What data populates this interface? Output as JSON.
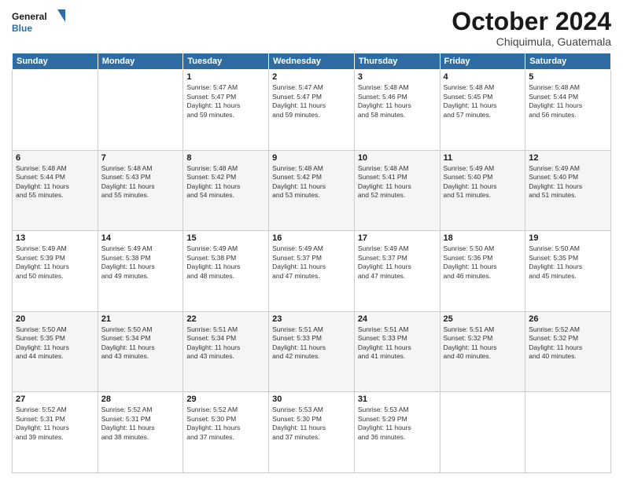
{
  "logo": {
    "line1": "General",
    "line2": "Blue"
  },
  "title": "October 2024",
  "subtitle": "Chiquimula, Guatemala",
  "days_header": [
    "Sunday",
    "Monday",
    "Tuesday",
    "Wednesday",
    "Thursday",
    "Friday",
    "Saturday"
  ],
  "weeks": [
    [
      {
        "day": "",
        "info": ""
      },
      {
        "day": "",
        "info": ""
      },
      {
        "day": "1",
        "info": "Sunrise: 5:47 AM\nSunset: 5:47 PM\nDaylight: 11 hours\nand 59 minutes."
      },
      {
        "day": "2",
        "info": "Sunrise: 5:47 AM\nSunset: 5:47 PM\nDaylight: 11 hours\nand 59 minutes."
      },
      {
        "day": "3",
        "info": "Sunrise: 5:48 AM\nSunset: 5:46 PM\nDaylight: 11 hours\nand 58 minutes."
      },
      {
        "day": "4",
        "info": "Sunrise: 5:48 AM\nSunset: 5:45 PM\nDaylight: 11 hours\nand 57 minutes."
      },
      {
        "day": "5",
        "info": "Sunrise: 5:48 AM\nSunset: 5:44 PM\nDaylight: 11 hours\nand 56 minutes."
      }
    ],
    [
      {
        "day": "6",
        "info": "Sunrise: 5:48 AM\nSunset: 5:44 PM\nDaylight: 11 hours\nand 55 minutes."
      },
      {
        "day": "7",
        "info": "Sunrise: 5:48 AM\nSunset: 5:43 PM\nDaylight: 11 hours\nand 55 minutes."
      },
      {
        "day": "8",
        "info": "Sunrise: 5:48 AM\nSunset: 5:42 PM\nDaylight: 11 hours\nand 54 minutes."
      },
      {
        "day": "9",
        "info": "Sunrise: 5:48 AM\nSunset: 5:42 PM\nDaylight: 11 hours\nand 53 minutes."
      },
      {
        "day": "10",
        "info": "Sunrise: 5:48 AM\nSunset: 5:41 PM\nDaylight: 11 hours\nand 52 minutes."
      },
      {
        "day": "11",
        "info": "Sunrise: 5:49 AM\nSunset: 5:40 PM\nDaylight: 11 hours\nand 51 minutes."
      },
      {
        "day": "12",
        "info": "Sunrise: 5:49 AM\nSunset: 5:40 PM\nDaylight: 11 hours\nand 51 minutes."
      }
    ],
    [
      {
        "day": "13",
        "info": "Sunrise: 5:49 AM\nSunset: 5:39 PM\nDaylight: 11 hours\nand 50 minutes."
      },
      {
        "day": "14",
        "info": "Sunrise: 5:49 AM\nSunset: 5:38 PM\nDaylight: 11 hours\nand 49 minutes."
      },
      {
        "day": "15",
        "info": "Sunrise: 5:49 AM\nSunset: 5:38 PM\nDaylight: 11 hours\nand 48 minutes."
      },
      {
        "day": "16",
        "info": "Sunrise: 5:49 AM\nSunset: 5:37 PM\nDaylight: 11 hours\nand 47 minutes."
      },
      {
        "day": "17",
        "info": "Sunrise: 5:49 AM\nSunset: 5:37 PM\nDaylight: 11 hours\nand 47 minutes."
      },
      {
        "day": "18",
        "info": "Sunrise: 5:50 AM\nSunset: 5:36 PM\nDaylight: 11 hours\nand 46 minutes."
      },
      {
        "day": "19",
        "info": "Sunrise: 5:50 AM\nSunset: 5:35 PM\nDaylight: 11 hours\nand 45 minutes."
      }
    ],
    [
      {
        "day": "20",
        "info": "Sunrise: 5:50 AM\nSunset: 5:35 PM\nDaylight: 11 hours\nand 44 minutes."
      },
      {
        "day": "21",
        "info": "Sunrise: 5:50 AM\nSunset: 5:34 PM\nDaylight: 11 hours\nand 43 minutes."
      },
      {
        "day": "22",
        "info": "Sunrise: 5:51 AM\nSunset: 5:34 PM\nDaylight: 11 hours\nand 43 minutes."
      },
      {
        "day": "23",
        "info": "Sunrise: 5:51 AM\nSunset: 5:33 PM\nDaylight: 11 hours\nand 42 minutes."
      },
      {
        "day": "24",
        "info": "Sunrise: 5:51 AM\nSunset: 5:33 PM\nDaylight: 11 hours\nand 41 minutes."
      },
      {
        "day": "25",
        "info": "Sunrise: 5:51 AM\nSunset: 5:32 PM\nDaylight: 11 hours\nand 40 minutes."
      },
      {
        "day": "26",
        "info": "Sunrise: 5:52 AM\nSunset: 5:32 PM\nDaylight: 11 hours\nand 40 minutes."
      }
    ],
    [
      {
        "day": "27",
        "info": "Sunrise: 5:52 AM\nSunset: 5:31 PM\nDaylight: 11 hours\nand 39 minutes."
      },
      {
        "day": "28",
        "info": "Sunrise: 5:52 AM\nSunset: 5:31 PM\nDaylight: 11 hours\nand 38 minutes."
      },
      {
        "day": "29",
        "info": "Sunrise: 5:52 AM\nSunset: 5:30 PM\nDaylight: 11 hours\nand 37 minutes."
      },
      {
        "day": "30",
        "info": "Sunrise: 5:53 AM\nSunset: 5:30 PM\nDaylight: 11 hours\nand 37 minutes."
      },
      {
        "day": "31",
        "info": "Sunrise: 5:53 AM\nSunset: 5:29 PM\nDaylight: 11 hours\nand 36 minutes."
      },
      {
        "day": "",
        "info": ""
      },
      {
        "day": "",
        "info": ""
      }
    ]
  ]
}
